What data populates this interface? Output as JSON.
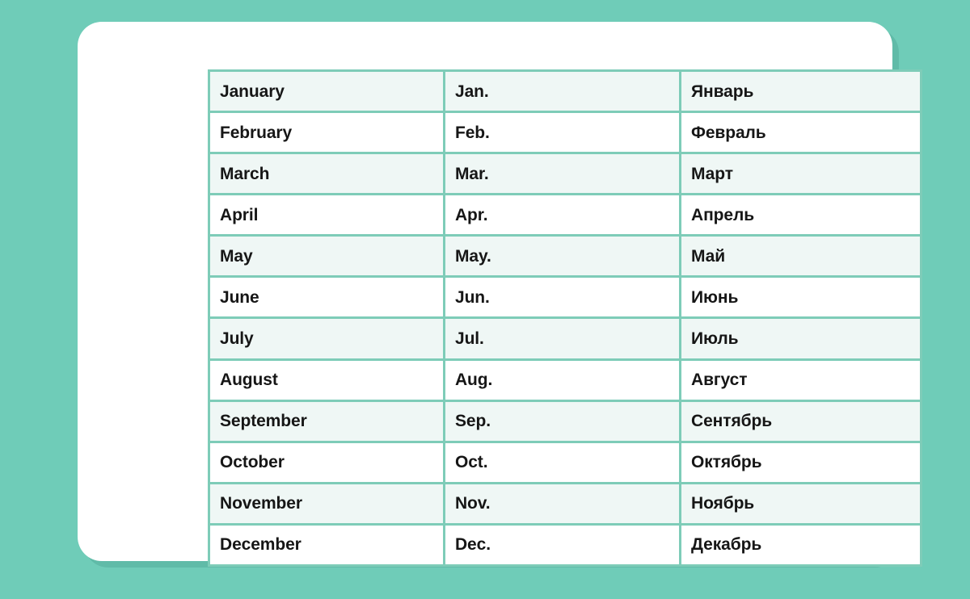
{
  "theme": {
    "background_color": "#6FCCB8",
    "card_color": "#FFFFFF",
    "border_color": "#7ECCB8",
    "row_tint_color": "#EFF7F5",
    "text_color": "#161616",
    "shadow_color": "#53AD9A"
  },
  "table": {
    "columns": [
      "full_name_en",
      "abbreviation_en",
      "name_ru"
    ],
    "row_count": 12,
    "rows": [
      {
        "full_name_en": "January",
        "abbreviation_en": "Jan.",
        "name_ru": "Январь",
        "tinted": true
      },
      {
        "full_name_en": "February",
        "abbreviation_en": "Feb.",
        "name_ru": "Февраль",
        "tinted": false
      },
      {
        "full_name_en": "March",
        "abbreviation_en": "Mar.",
        "name_ru": "Март",
        "tinted": true
      },
      {
        "full_name_en": "April",
        "abbreviation_en": "Apr.",
        "name_ru": "Апрель",
        "tinted": false
      },
      {
        "full_name_en": "May",
        "abbreviation_en": "May.",
        "name_ru": "Май",
        "tinted": true
      },
      {
        "full_name_en": "June",
        "abbreviation_en": "Jun.",
        "name_ru": "Июнь",
        "tinted": false
      },
      {
        "full_name_en": "July",
        "abbreviation_en": "Jul.",
        "name_ru": "Июль",
        "tinted": true
      },
      {
        "full_name_en": "August",
        "abbreviation_en": "Aug.",
        "name_ru": "Август",
        "tinted": false
      },
      {
        "full_name_en": "September",
        "abbreviation_en": "Sep.",
        "name_ru": "Сентябрь",
        "tinted": true
      },
      {
        "full_name_en": "October",
        "abbreviation_en": "Oct.",
        "name_ru": "Октябрь",
        "tinted": false
      },
      {
        "full_name_en": "November",
        "abbreviation_en": "Nov.",
        "name_ru": "Ноябрь",
        "tinted": true
      },
      {
        "full_name_en": "December",
        "abbreviation_en": "Dec.",
        "name_ru": "Декабрь",
        "tinted": false
      }
    ]
  }
}
